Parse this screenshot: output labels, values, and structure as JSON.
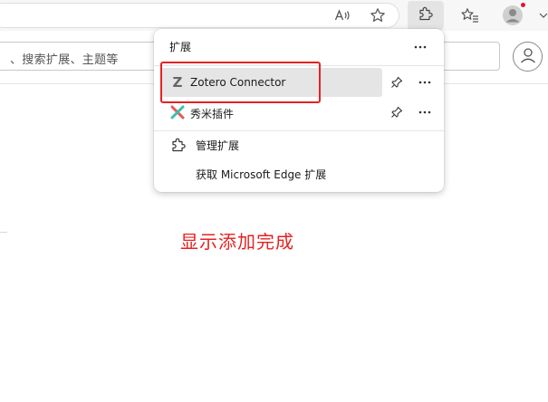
{
  "search": {
    "placeholder": "、搜索扩展、主题等"
  },
  "extensions_menu": {
    "title": "扩展",
    "items": [
      {
        "label": "Zotero Connector",
        "icon": "zotero-icon"
      },
      {
        "label": "秀米插件",
        "icon": "xiumi-icon"
      }
    ],
    "manage_label": "管理扩展",
    "get_label": "获取 Microsoft Edge 扩展"
  },
  "annotation": {
    "text": "显示添加完成",
    "color": "#e42222"
  },
  "toolbar": {
    "icons": [
      "read-aloud-icon",
      "favorite-star-icon",
      "extensions-icon",
      "favorites-icon",
      "profile-icon",
      "chevron-down-icon"
    ]
  }
}
